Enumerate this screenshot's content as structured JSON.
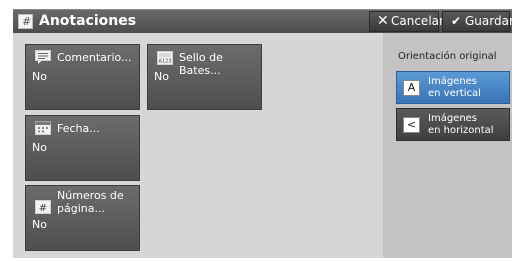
{
  "header": {
    "title": "Anotaciones",
    "title_icon_glyph": "#",
    "cancel_label": "Cancelar",
    "save_label": "Guardar"
  },
  "tiles": [
    {
      "label": "Comentario...",
      "value": "No",
      "icon": "comment-icon"
    },
    {
      "label": "Sello de Bates...",
      "value": "No",
      "icon": "bates-stamp-icon",
      "icon_text": "A123"
    },
    {
      "label": "Fecha...",
      "value": "No",
      "icon": "calendar-icon"
    },
    {
      "label": "Números de\npágina...",
      "value": "No",
      "icon": "page-number-icon",
      "icon_text": "#"
    }
  ],
  "orientation": {
    "label": "Orientación original",
    "options": [
      {
        "label": "Imágenes\nen vertical",
        "glyph": "A",
        "selected": true
      },
      {
        "label": "Imágenes\nen horizontal",
        "glyph": "<",
        "selected": false
      }
    ]
  },
  "colors": {
    "header": "#555555",
    "selected": "#4a86c6",
    "content_bg": "#d6d6d6",
    "panel_bg": "#c3c3c3"
  }
}
